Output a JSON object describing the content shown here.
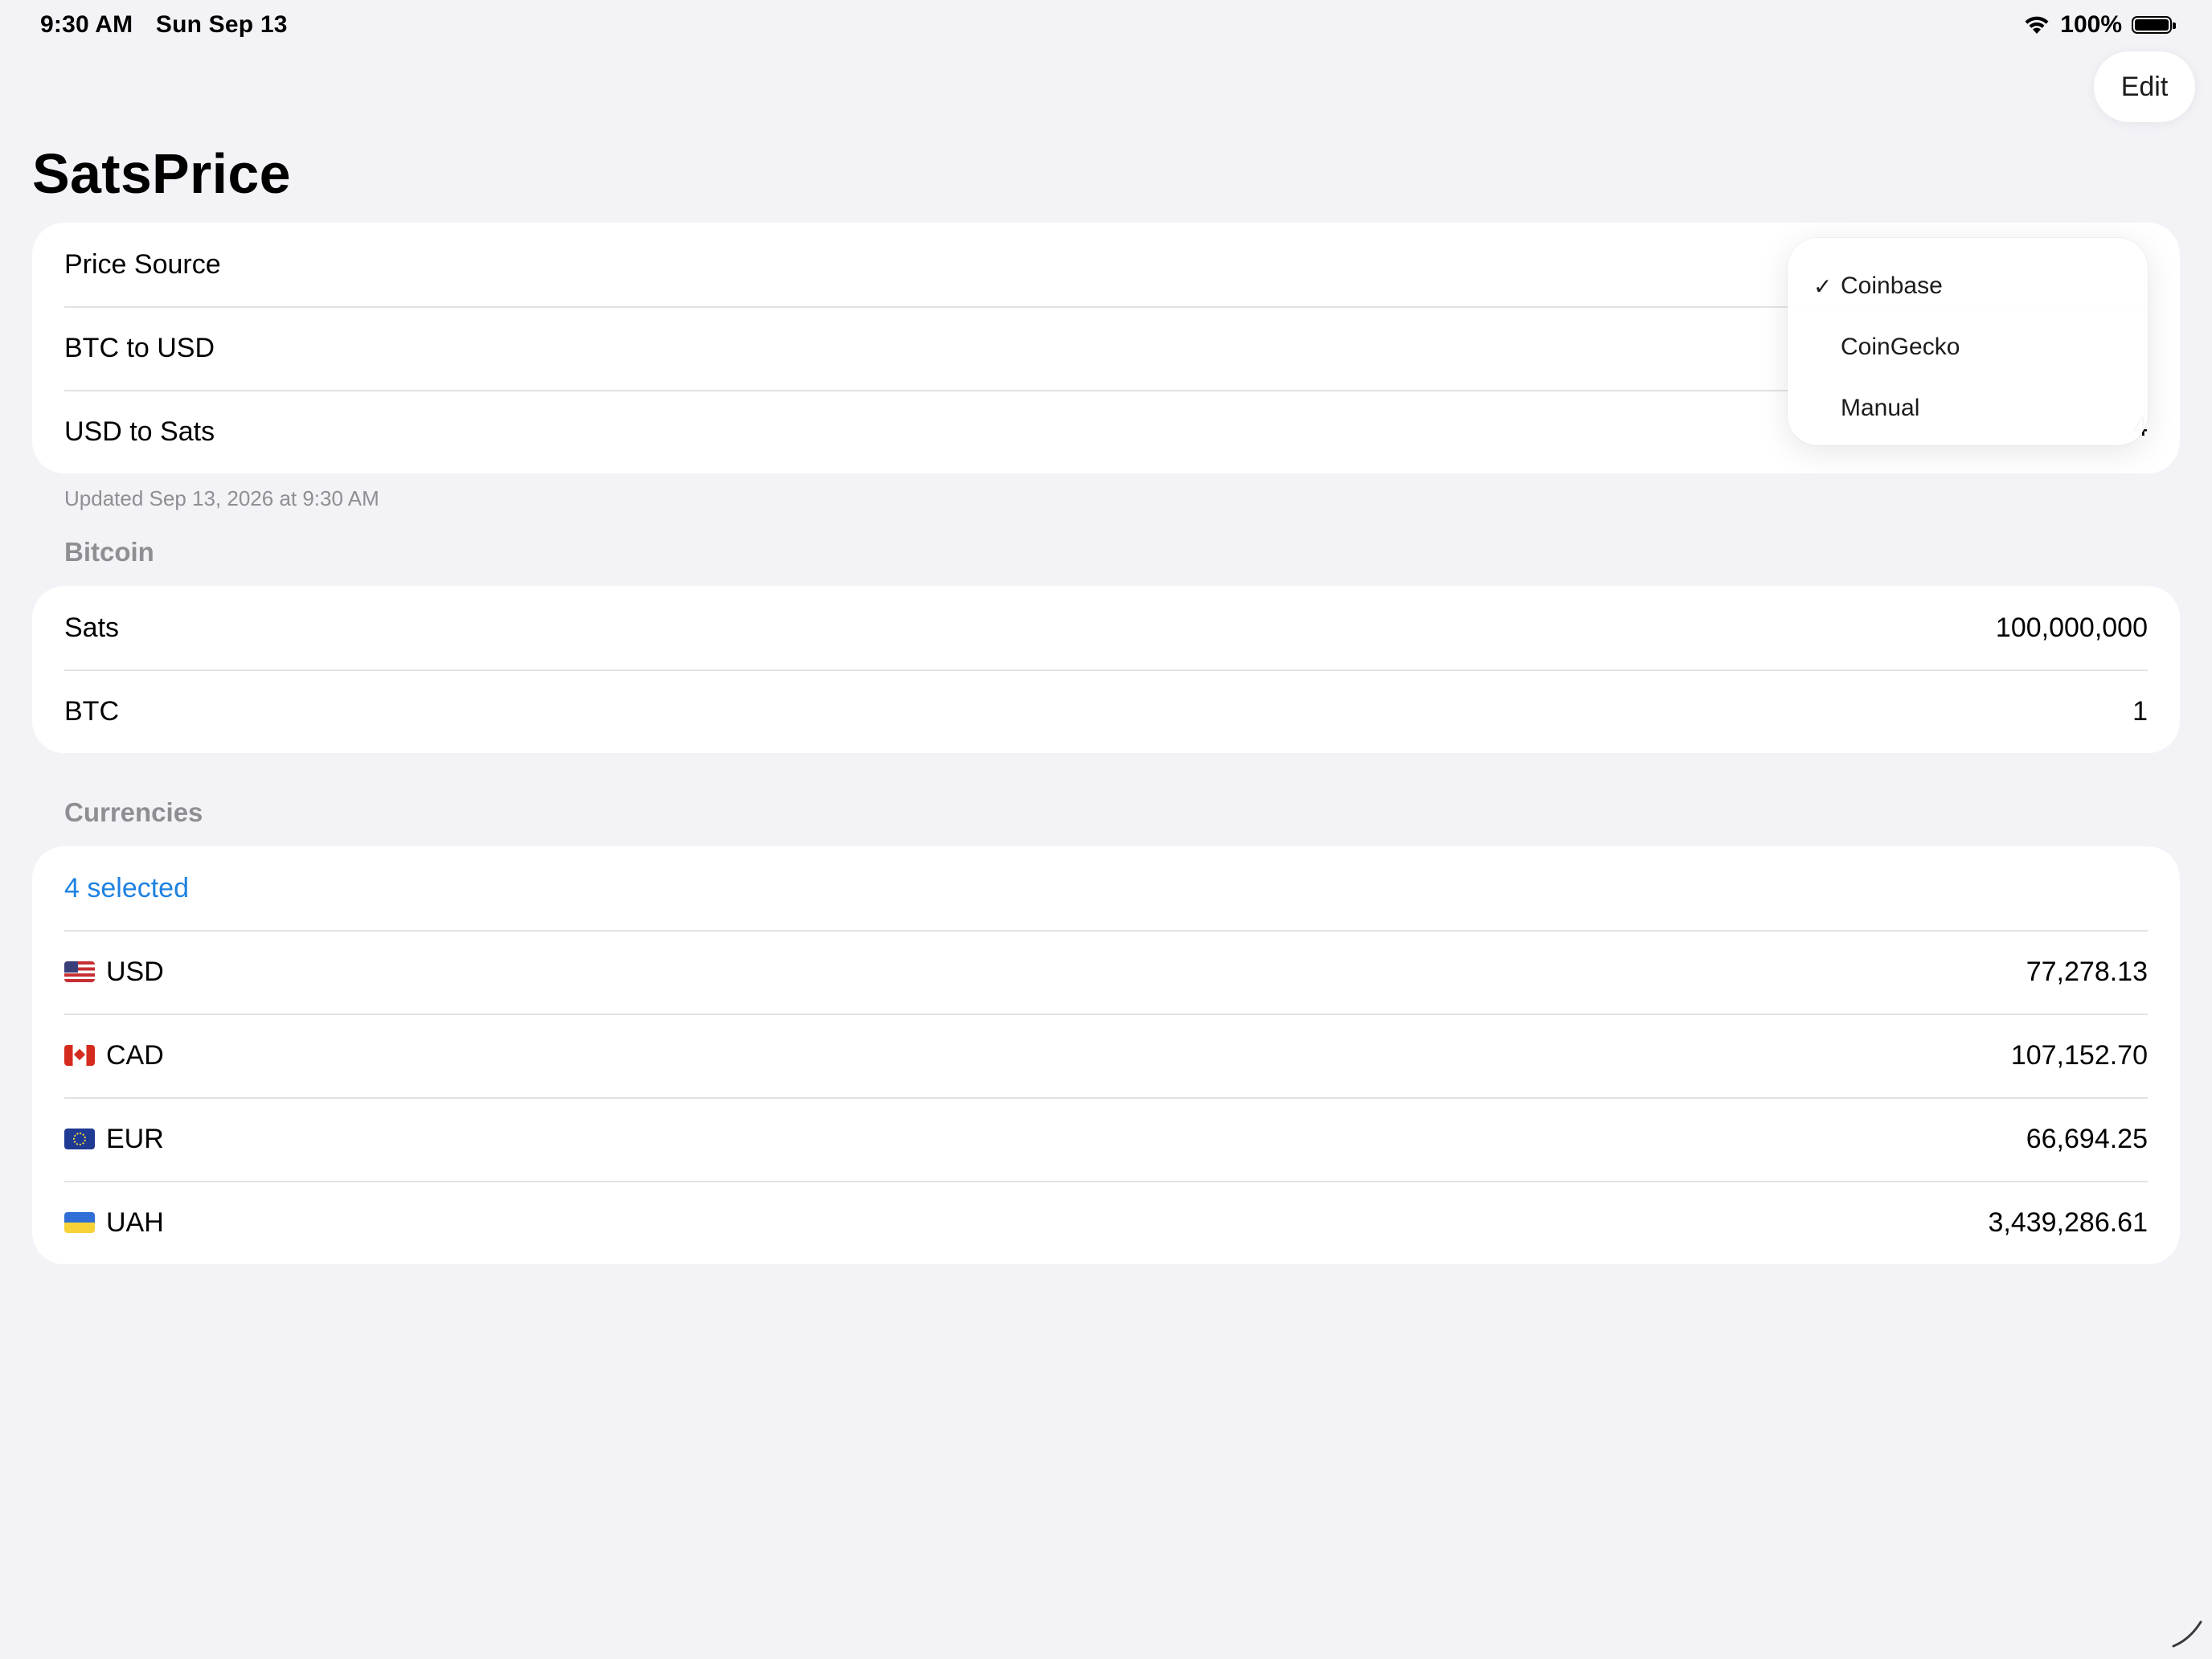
{
  "status_bar": {
    "time": "9:30 AM",
    "date": "Sun Sep 13",
    "battery": "100%",
    "icons": [
      "wifi-icon",
      "battery-icon"
    ]
  },
  "nav": {
    "edit_label": "Edit"
  },
  "title": "SatsPrice",
  "price_card": {
    "rows": [
      {
        "label": "Price Source"
      },
      {
        "label": "BTC to USD"
      },
      {
        "label": "USD to Sats",
        "value_partial": "4"
      }
    ],
    "footnote": "Updated Sep 13, 2026 at 9:30 AM"
  },
  "price_source_menu": {
    "selected": "Coinbase",
    "options": [
      "Coinbase",
      "CoinGecko",
      "Manual"
    ],
    "check_glyph": "✓"
  },
  "bitcoin": {
    "header": "Bitcoin",
    "rows": [
      {
        "label": "Sats",
        "value": "100,000,000"
      },
      {
        "label": "BTC",
        "value": "1"
      }
    ]
  },
  "currencies": {
    "header": "Currencies",
    "selected_label": "4 selected",
    "link_color": "#1d82e2",
    "rows": [
      {
        "code": "USD",
        "flag": "us-flag-icon",
        "value": "77,278.13"
      },
      {
        "code": "CAD",
        "flag": "ca-flag-icon",
        "value": "107,152.70"
      },
      {
        "code": "EUR",
        "flag": "eu-flag-icon",
        "value": "66,694.25"
      },
      {
        "code": "UAH",
        "flag": "ua-flag-icon",
        "value": "3,439,286.61"
      }
    ]
  }
}
